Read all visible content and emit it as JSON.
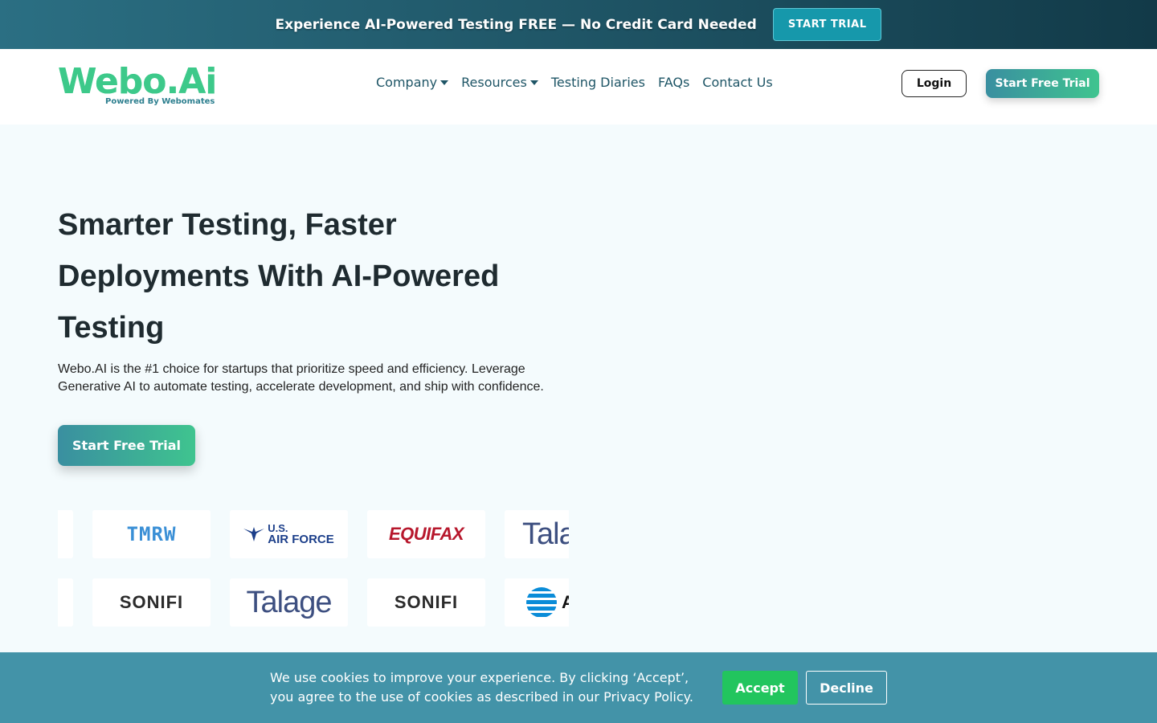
{
  "promo": {
    "text": "Experience AI-Powered Testing FREE — No Credit Card Needed",
    "button": "START TRIAL"
  },
  "header": {
    "logo_main": "Webo.Ai",
    "logo_sub": "Powered By Webomates",
    "nav": [
      {
        "label": "Company",
        "has_dropdown": true
      },
      {
        "label": "Resources",
        "has_dropdown": true
      },
      {
        "label": "Testing Diaries",
        "has_dropdown": false
      },
      {
        "label": "FAQs",
        "has_dropdown": false
      },
      {
        "label": "Contact Us",
        "has_dropdown": false
      }
    ],
    "login": "Login",
    "trial": "Start Free Trial"
  },
  "hero": {
    "title": "Smarter Testing, Faster Deployments With AI-Powered Testing",
    "description": "Webo.AI is the #1 choice for startups that prioritize speed and efficiency. Leverage Generative AI to automate testing, accelerate development, and ship with confidence.",
    "cta": "Start Free Trial"
  },
  "logos": {
    "row1": [
      "TMRW",
      "U.S. AIR FORCE",
      "EQUIFAX",
      "Talage"
    ],
    "row2": [
      "SONIFI",
      "Talage",
      "SONIFI",
      "AT&T"
    ],
    "usaf_top": "U.S.",
    "usaf_bottom": "AIR FORCE",
    "att_fragment": "A"
  },
  "cookie": {
    "text": "We use cookies to improve your experience. By clicking ‘Accept’, you agree to the use of cookies as described in our Privacy Policy.",
    "accept": "Accept",
    "decline": "Decline"
  },
  "colors": {
    "brand_green": "#3dc98a",
    "brand_teal": "#3a8fa0",
    "cookie_bg": "#4393a8",
    "accept_green": "#22c55e"
  }
}
